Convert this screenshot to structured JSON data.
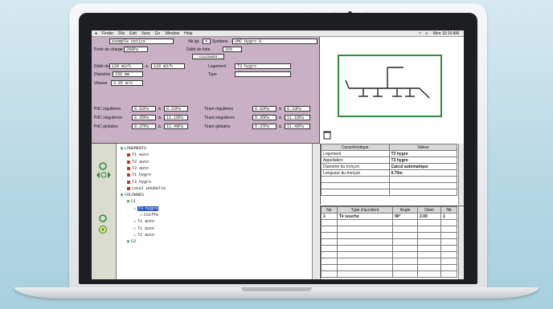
{
  "menubar": {
    "apple": "",
    "items": [
      "Finder",
      "File",
      "Edit",
      "View",
      "Go",
      "Window",
      "Help"
    ],
    "clock": "Mon 10:10 AM"
  },
  "form": {
    "project_name": "exemple notice",
    "nb_logements_label": "Nb lgt.",
    "nb_logements": "4",
    "systeme_label": "Système",
    "systeme": "VMC Hygro A",
    "perte_charge_label": "Perte de charge maxi",
    "perte_charge": "200Pa",
    "debit_fuite_label": "Débit de fuite",
    "debit_fuite": "20%",
    "colonnes_button": "COLONNES",
    "debit_label": "Débit de",
    "debit_min": "120 m3/h",
    "debit_sep": "à",
    "debit_max": "110 m3/h",
    "logement_label": "Logement",
    "logement": "T3 hygro",
    "diametre_label": "Diamètre",
    "diametre": "150 mm",
    "type_label": "Type",
    "type": "",
    "vitesse_label": "Vitesse",
    "vitesse": "3.05 m/s",
    "pdc_rows": [
      {
        "left_label": "PdC régulières",
        "left_a": "0.02Pa",
        "left_b": "0.33Pa",
        "right_label": "Tirant régulières",
        "right_a": "0.02Pa",
        "right_b": "0.33Pa"
      },
      {
        "left_label": "PdC singulières",
        "left_a": "0.35Pa",
        "left_b": "11.16Pa",
        "right_label": "Tirant singulières",
        "right_a": "0.35Pa",
        "right_b": "11.16Pa"
      },
      {
        "left_label": "PdC globales",
        "left_a": "0.37Pa",
        "left_b": "11.49Pa",
        "right_label": "Tirant globales",
        "right_a": "0.37Pa",
        "right_b": "11.49Pa"
      }
    ],
    "range_sep": "à"
  },
  "tree": {
    "items": [
      {
        "label": "LOGEMENTS",
        "indent": 0,
        "marker": "box"
      },
      {
        "label": "T1 auto",
        "indent": 1,
        "marker": "flag"
      },
      {
        "label": "T2 auto",
        "indent": 1,
        "marker": "flag"
      },
      {
        "label": "T3 auto",
        "indent": 1,
        "marker": "flag"
      },
      {
        "label": "T1 hygro",
        "indent": 1,
        "marker": "flag"
      },
      {
        "label": "T3 hygro",
        "indent": 1,
        "marker": "flag"
      },
      {
        "label": "Local poubelle",
        "indent": 1,
        "marker": "flag"
      },
      {
        "label": "COLONNES",
        "indent": 0,
        "marker": "box"
      },
      {
        "label": "C1",
        "indent": 1,
        "marker": "box"
      },
      {
        "label": "T3 hygro",
        "indent": 2,
        "marker": "node",
        "selected": true
      },
      {
        "label": "Coiffe",
        "indent": 3,
        "marker": "node"
      },
      {
        "label": "T1 auto",
        "indent": 2,
        "marker": "node"
      },
      {
        "label": "T1 auto",
        "indent": 2,
        "marker": "node"
      },
      {
        "label": "T2 auto",
        "indent": 2,
        "marker": "node"
      },
      {
        "label": "C2",
        "indent": 1,
        "marker": "box"
      }
    ]
  },
  "props": {
    "headers": [
      "Caractéristique",
      "Valeur"
    ],
    "rows": [
      [
        "Logement",
        "T3 hygro"
      ],
      [
        "Appellation",
        "T3 hygro"
      ],
      [
        "Diamètre du tronçon",
        "Calcul automatique"
      ],
      [
        "Longueur du tronçon",
        "0.70m"
      ]
    ]
  },
  "accidents": {
    "headers": [
      "No",
      "Type d'accident",
      "Angle",
      "Diam",
      "Nb"
    ],
    "rows": [
      [
        "1",
        "Té souche",
        "90°",
        "2.00",
        "1"
      ]
    ]
  },
  "colors": {
    "form_bg": "#c9b0c5",
    "selection": "#2a56c6",
    "diagram_frame": "#2c8c3a"
  }
}
